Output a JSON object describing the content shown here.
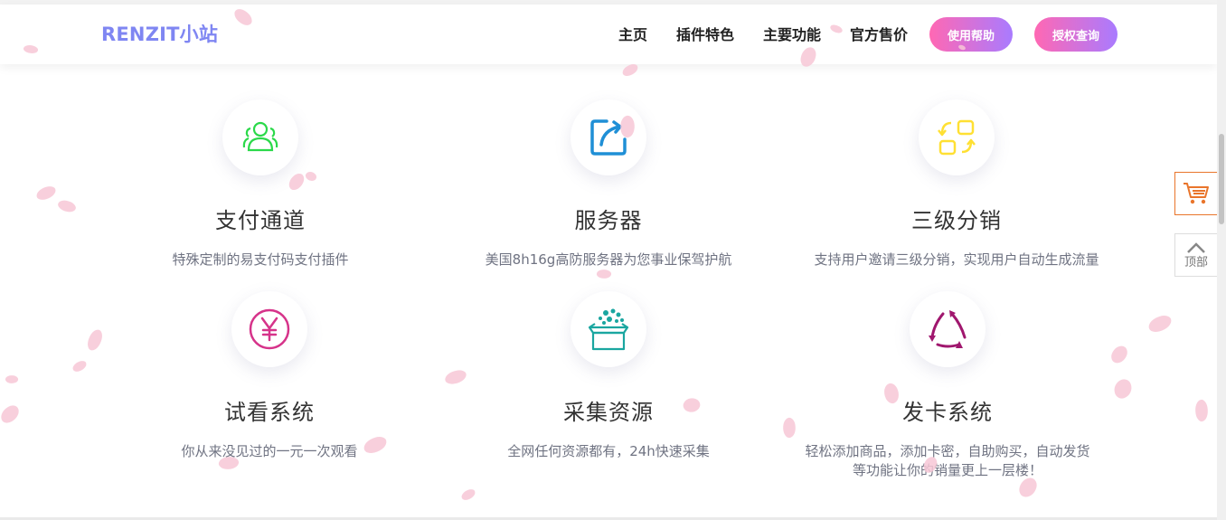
{
  "header": {
    "logo": "RENZIT小站",
    "nav": [
      "主页",
      "插件特色",
      "主要功能",
      "官方售价"
    ],
    "buttons": [
      "使用帮助",
      "授权查询"
    ]
  },
  "features": [
    {
      "title": "支付通道",
      "desc": "特殊定制的易支付码支付插件",
      "icon": "users-icon",
      "color": "#2bd94a"
    },
    {
      "title": "服务器",
      "desc": "美国8h16g高防服务器为您事业保驾护航",
      "icon": "share-box-icon",
      "color": "#1f8fd6"
    },
    {
      "title": "三级分销",
      "desc": "支持用户邀请三级分销，实现用户自动生成流量",
      "icon": "exchange-icon",
      "color": "#ffe033"
    },
    {
      "title": "试看系统",
      "desc": "你从来没见过的一元一次观看",
      "icon": "yen-icon",
      "color": "#d6338a"
    },
    {
      "title": "采集资源",
      "desc": "全网任何资源都有，24h快速采集",
      "icon": "box-icon",
      "color": "#1aa6a0"
    },
    {
      "title": "发卡系统",
      "desc": "轻松添加商品，添加卡密，自助购买，自动发货\n等功能让你的销量更上一层楼！",
      "icon": "cycle-icon",
      "color": "#a0176e"
    }
  ],
  "side": {
    "top_label": "顶部",
    "cart_color": "#e9752b"
  }
}
